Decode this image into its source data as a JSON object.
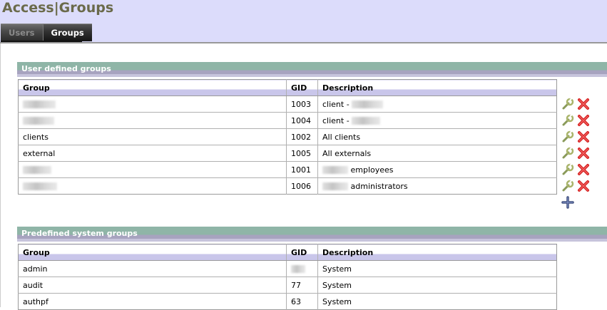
{
  "header": {
    "title": "Access|Groups",
    "tabs": [
      {
        "label": "Users",
        "active": false
      },
      {
        "label": "Groups",
        "active": true
      }
    ]
  },
  "user_groups": {
    "title": "User defined groups",
    "columns": [
      "Group",
      "GID",
      "Description"
    ],
    "rows": [
      {
        "group": "",
        "gid": "1003",
        "desc_prefix": "client -",
        "desc_suffix": ""
      },
      {
        "group": "",
        "gid": "1004",
        "desc_prefix": "client -",
        "desc_suffix": ""
      },
      {
        "group": "clients",
        "gid": "1002",
        "desc_prefix": "All clients",
        "desc_suffix": ""
      },
      {
        "group": "external",
        "gid": "1005",
        "desc_prefix": "All externals",
        "desc_suffix": ""
      },
      {
        "group": "",
        "gid": "1001",
        "desc_prefix": "",
        "desc_suffix": "employees"
      },
      {
        "group": "",
        "gid": "1006",
        "desc_prefix": "",
        "desc_suffix": "administrators"
      }
    ],
    "icons": {
      "edit": "wrench-edit-icon",
      "delete": "red-x-delete-icon",
      "add": "plus-add-icon"
    }
  },
  "system_groups": {
    "title": "Predefined system groups",
    "columns": [
      "Group",
      "GID",
      "Description"
    ],
    "rows": [
      {
        "group": "admin",
        "gid": "",
        "desc": "System"
      },
      {
        "group": "audit",
        "gid": "77",
        "desc": "System"
      },
      {
        "group": "authpf",
        "gid": "63",
        "desc": "System"
      }
    ]
  },
  "colors": {
    "header_bg": "#dcdcfb",
    "title_color": "#6a6a4a",
    "section_bar": "#8fb5a7",
    "delete_red": "#d42020"
  }
}
